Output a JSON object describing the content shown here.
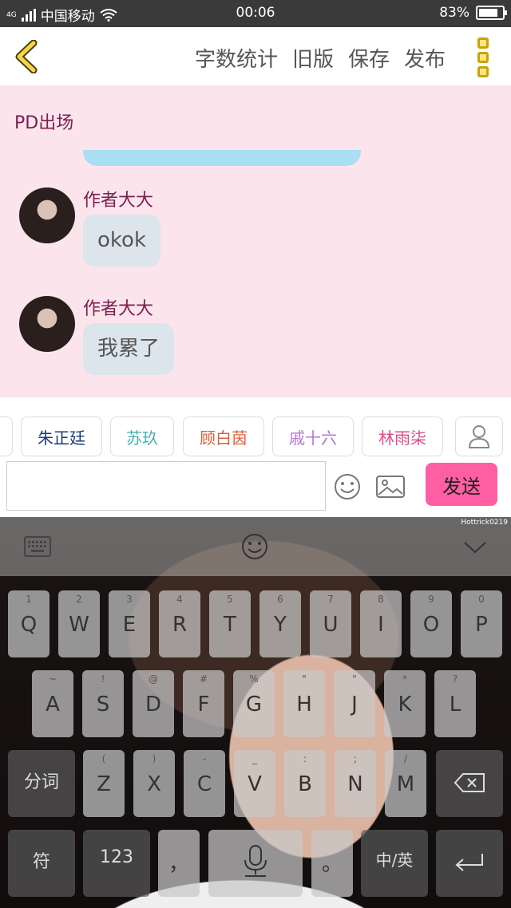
{
  "status": {
    "network": "4G",
    "carrier": "中国移动",
    "time": "00:06",
    "battery_percent": "83%",
    "battery_level": 0.83
  },
  "topbar": {
    "back_icon": "chevron-left-icon",
    "actions": [
      "字数统计",
      "旧版",
      "保存",
      "发布"
    ],
    "menu_icon": "more-vertical-icon"
  },
  "chat": {
    "chapter_title": "PD出场",
    "messages": [
      {
        "author": "作者大大",
        "text": "okok"
      },
      {
        "author": "作者大大",
        "text": "我累了"
      }
    ]
  },
  "characters": [
    {
      "name": "朱正廷",
      "color": "#1a3a7a"
    },
    {
      "name": "苏玖",
      "color": "#4ab0b0"
    },
    {
      "name": "顾白茵",
      "color": "#e0603a"
    },
    {
      "name": "戚十六",
      "color": "#b07ad0"
    },
    {
      "name": "林雨柒",
      "color": "#e04a8a"
    }
  ],
  "composer": {
    "input_value": "",
    "send_label": "发送",
    "send_color": "#ff5fa2"
  },
  "keyboard": {
    "watermark": "Hottrick0219",
    "row1": [
      {
        "key": "Q",
        "hint": "1"
      },
      {
        "key": "W",
        "hint": "2"
      },
      {
        "key": "E",
        "hint": "3"
      },
      {
        "key": "R",
        "hint": "4"
      },
      {
        "key": "T",
        "hint": "5"
      },
      {
        "key": "Y",
        "hint": "6"
      },
      {
        "key": "U",
        "hint": "7"
      },
      {
        "key": "I",
        "hint": "8"
      },
      {
        "key": "O",
        "hint": "9"
      },
      {
        "key": "P",
        "hint": "0"
      }
    ],
    "row2": [
      {
        "key": "A",
        "hint": "~"
      },
      {
        "key": "S",
        "hint": "!"
      },
      {
        "key": "D",
        "hint": "@"
      },
      {
        "key": "F",
        "hint": "#"
      },
      {
        "key": "G",
        "hint": "%"
      },
      {
        "key": "H",
        "hint": "\""
      },
      {
        "key": "J",
        "hint": "\""
      },
      {
        "key": "K",
        "hint": "*"
      },
      {
        "key": "L",
        "hint": "?"
      }
    ],
    "row3_left": "分词",
    "row3": [
      {
        "key": "Z",
        "hint": "("
      },
      {
        "key": "X",
        "hint": ")"
      },
      {
        "key": "C",
        "hint": "-"
      },
      {
        "key": "V",
        "hint": "_"
      },
      {
        "key": "B",
        "hint": ":"
      },
      {
        "key": "N",
        "hint": ";"
      },
      {
        "key": "M",
        "hint": "/"
      }
    ],
    "row4": {
      "symbol": "符",
      "num": "123",
      "comma": "，",
      "period": "。",
      "lang": "中/英"
    }
  }
}
